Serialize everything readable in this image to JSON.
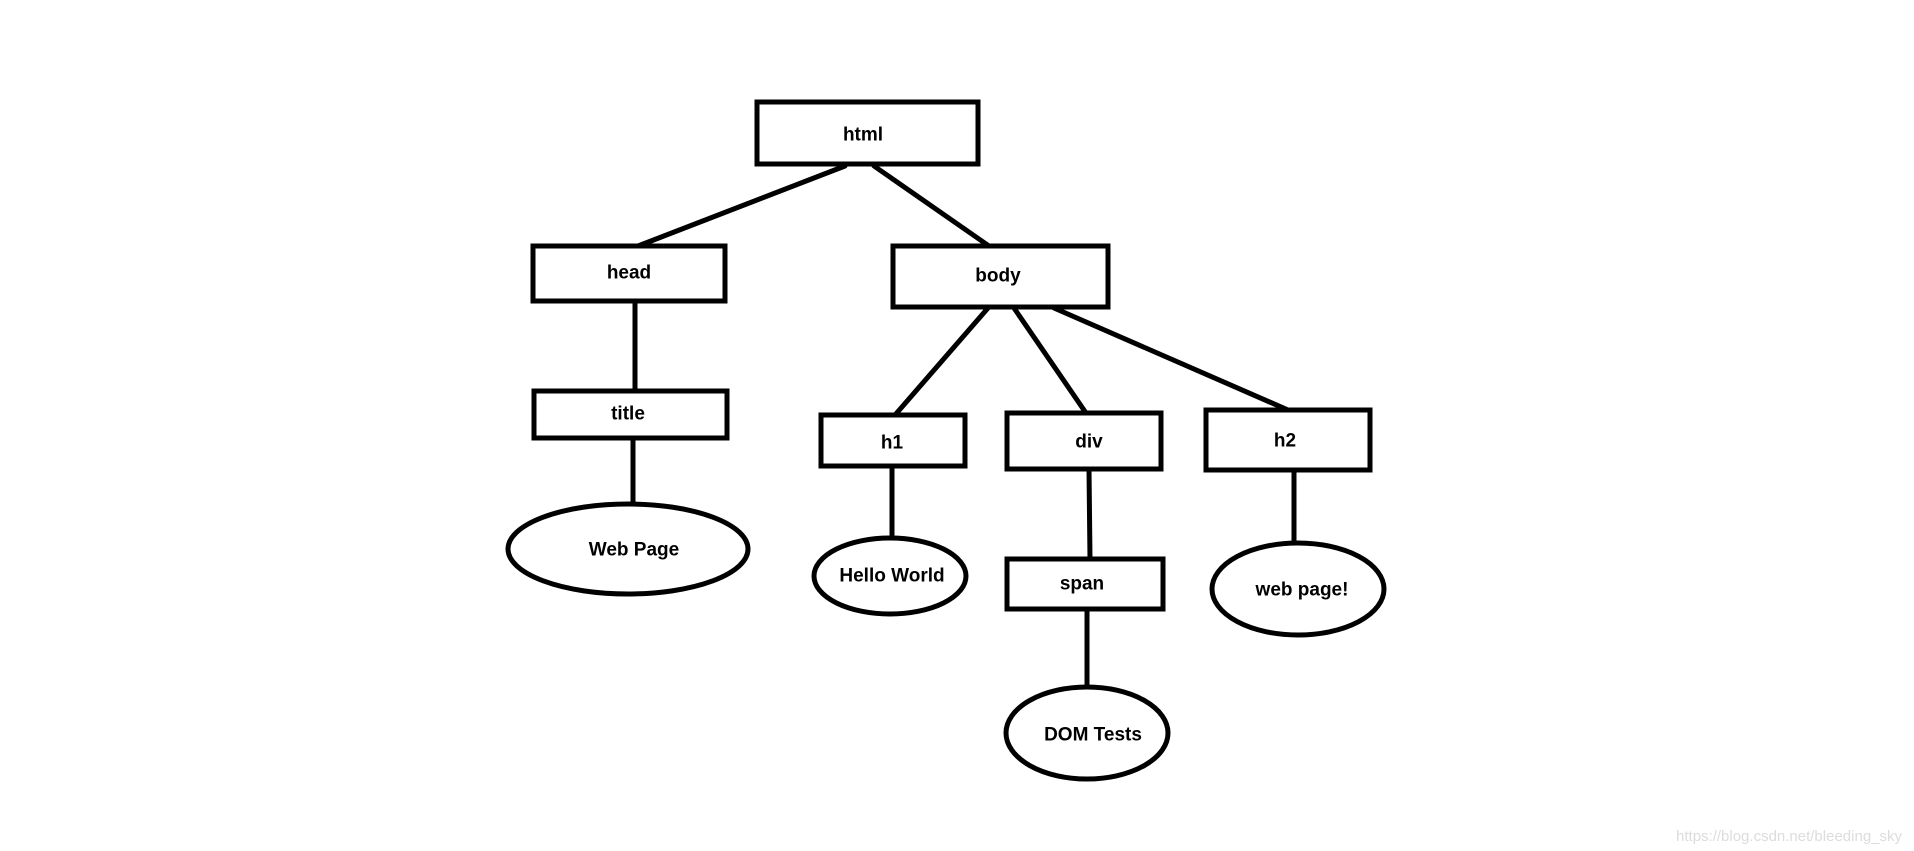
{
  "nodes": {
    "html": {
      "label": "html",
      "shape": "rect"
    },
    "head": {
      "label": "head",
      "shape": "rect"
    },
    "body": {
      "label": "body",
      "shape": "rect"
    },
    "title": {
      "label": "title",
      "shape": "rect"
    },
    "h1": {
      "label": "h1",
      "shape": "rect"
    },
    "div": {
      "label": "div",
      "shape": "rect"
    },
    "h2": {
      "label": "h2",
      "shape": "rect"
    },
    "span": {
      "label": "span",
      "shape": "rect"
    },
    "text_webpage": {
      "label": "Web Page",
      "shape": "ellipse"
    },
    "text_helloworld": {
      "label": "Hello World",
      "shape": "ellipse"
    },
    "text_domtests": {
      "label": "DOM Tests",
      "shape": "ellipse"
    },
    "text_webpage2": {
      "label": "web page!",
      "shape": "ellipse"
    }
  },
  "edges": [
    [
      "html",
      "head"
    ],
    [
      "html",
      "body"
    ],
    [
      "head",
      "title"
    ],
    [
      "title",
      "text_webpage"
    ],
    [
      "body",
      "h1"
    ],
    [
      "body",
      "div"
    ],
    [
      "body",
      "h2"
    ],
    [
      "h1",
      "text_helloworld"
    ],
    [
      "div",
      "span"
    ],
    [
      "span",
      "text_domtests"
    ],
    [
      "h2",
      "text_webpage2"
    ]
  ],
  "watermark": "https://blog.csdn.net/bleeding_sky",
  "colors": {
    "stroke": "#000000",
    "background": "#ffffff",
    "watermark": "#dcdcdc"
  }
}
